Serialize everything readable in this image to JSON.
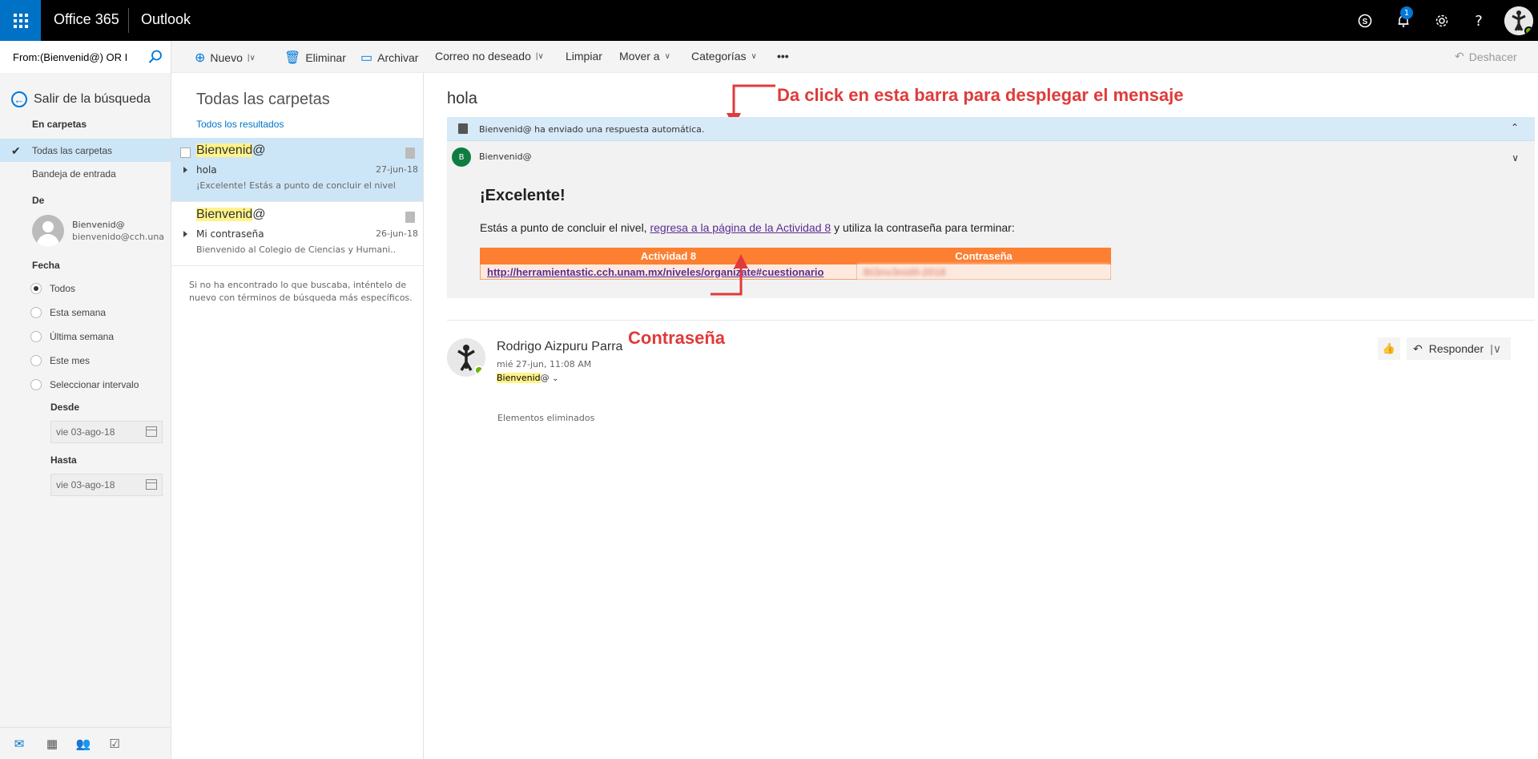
{
  "topbar": {
    "brand": "Office 365",
    "app": "Outlook",
    "notifications_count": "1",
    "icons": [
      "skype-icon",
      "bell-icon",
      "gear-icon",
      "help-icon",
      "avatar"
    ]
  },
  "search": {
    "value": "From:(Bienvenid@) OR I"
  },
  "commands": {
    "nuevo": "Nuevo",
    "eliminar": "Eliminar",
    "archivar": "Archivar",
    "no_deseado": "Correo no deseado",
    "limpiar": "Limpiar",
    "mover": "Mover a",
    "categorias": "Categorías",
    "more": "•••",
    "deshacer": "Deshacer"
  },
  "leftnav": {
    "back": "Salir de la búsqueda",
    "in_folders": "En carpetas",
    "folders": [
      "Todas las carpetas",
      "Bandeja de entrada"
    ],
    "from_heading": "De",
    "from_name": "Bienvenid@",
    "from_email": "bienvenido@cch.unam.",
    "date_heading": "Fecha",
    "date_options": [
      "Todos",
      "Esta semana",
      "Última semana",
      "Este mes",
      "Seleccionar intervalo"
    ],
    "desde_label": "Desde",
    "desde_value": "vie 03-ago-18",
    "hasta_label": "Hasta",
    "hasta_value": "vie 03-ago-18"
  },
  "messagelist": {
    "title": "Todas las carpetas",
    "subtitle": "Todos los resultados",
    "messages": [
      {
        "sender_highlight": "Bienvenid",
        "sender_rest": "@",
        "subject": "hola",
        "date": "27-jun-18",
        "preview": "¡Excelente! Estás a punto de concluir el nivel,..."
      },
      {
        "sender_highlight": "Bienvenid",
        "sender_rest": "@",
        "subject": "Mi contraseña",
        "date": "26-jun-18",
        "preview": "Bienvenido al Colegio de Ciencias y Humani..."
      }
    ],
    "no_results": "Si no ha encontrado lo que buscaba, inténtelo de nuevo con términos de búsqueda más específicos."
  },
  "reading": {
    "subject": "hola",
    "annotation_top": "Da click en esta barra para desplegar el mensaje",
    "annotation_bottom": "Contraseña",
    "auto_reply_text": "Bienvenid@ ha enviado una respuesta automática.",
    "auto_from": "Bienvenid@",
    "auto_avatar_letter": "B",
    "heading": "¡Excelente!",
    "body_before": "Estás a punto de concluir el nivel, ",
    "body_link": "regresa a la página de la Actividad 8",
    "body_after": " y utiliza la contraseña para terminar:",
    "table": {
      "col1": "Actividad 8",
      "col2": "Contraseña",
      "link": "http://herramientastic.cch.unam.mx/niveles/organizate#cuestionario",
      "password": "Bi3nv3nid0-2018"
    },
    "sender_name": "Rodrigo Aizpuru Parra",
    "sender_date": "mié 27-jun, 11:08 AM",
    "to_highlight": "Bienvenid",
    "to_rest": "@",
    "reply": "Responder",
    "folder": "Elementos eliminados"
  },
  "colors": {
    "brand_blue": "#0072c6",
    "selection": "#cde6f7",
    "annotation_red": "#e03a3a",
    "table_header": "#fd7f32"
  }
}
